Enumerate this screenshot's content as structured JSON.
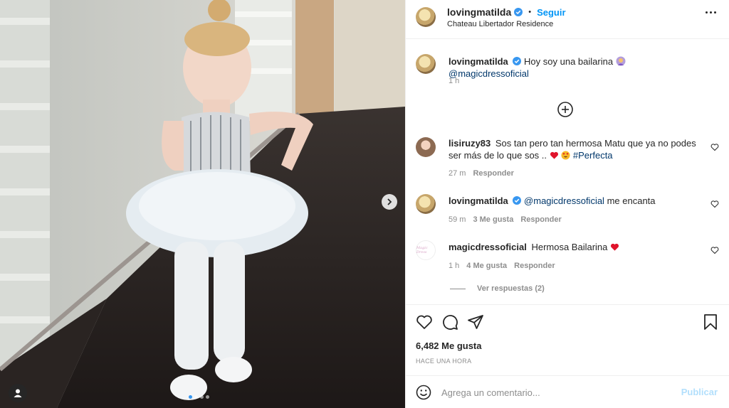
{
  "header": {
    "username": "lovingmatilda",
    "follow_label": "Seguir",
    "location": "Chateau Libertador Residence"
  },
  "caption": {
    "username": "lovingmatilda",
    "text": "Hoy soy una bailarina",
    "mention": "@magicdressoficial",
    "time": "1 h"
  },
  "comments": [
    {
      "username": "lisiruzy83",
      "text": "Sos tan pero tan hermosa Matu que ya no podes ser más de lo que sos ..",
      "hashtag": "#Perfecta",
      "time": "27 m",
      "reply_label": "Responder"
    },
    {
      "username": "lovingmatilda",
      "mention": "@magicdressoficial",
      "text": "me encanta",
      "time": "59 m",
      "likes": "3 Me gusta",
      "reply_label": "Responder"
    },
    {
      "username": "magicdressoficial",
      "avatar_text": "Magic Dress",
      "text": "Hermosa Bailarina",
      "time": "1 h",
      "likes": "4 Me gusta",
      "reply_label": "Responder",
      "view_replies": "Ver respuestas (2)"
    }
  ],
  "post": {
    "likes": "6,482 Me gusta",
    "timestamp": "HACE UNA HORA"
  },
  "add_comment": {
    "placeholder": "Agrega un comentario...",
    "publish_label": "Publicar"
  },
  "carousel": {
    "total": 4,
    "active": 1
  },
  "colors": {
    "accent": "#0095f6",
    "verified": "#3897f0",
    "text": "#262626",
    "muted": "#8e8e8e"
  },
  "icons": [
    "more-icon",
    "verified-icon",
    "load-more-icon",
    "heart-icon",
    "comment-icon",
    "share-icon",
    "save-icon",
    "emoji-icon",
    "next-arrow-icon",
    "user-tag-icon"
  ]
}
